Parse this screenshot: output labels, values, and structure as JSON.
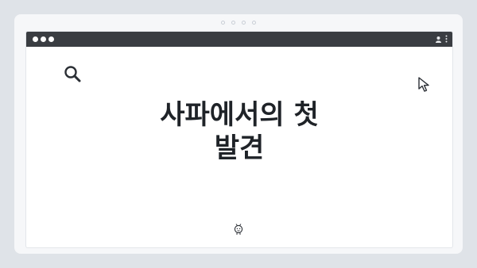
{
  "window": {
    "title_line1": "사파에서의 첫",
    "title_line2": "발견"
  },
  "icons": {
    "search": "search-icon",
    "cursor": "cursor-icon",
    "mascot": "bulb-face-icon",
    "user": "user-icon",
    "menu": "more-vertical-icon"
  },
  "colors": {
    "background": "#dfe3e8",
    "titlebar": "#3a3d42",
    "text": "#1f2328"
  }
}
